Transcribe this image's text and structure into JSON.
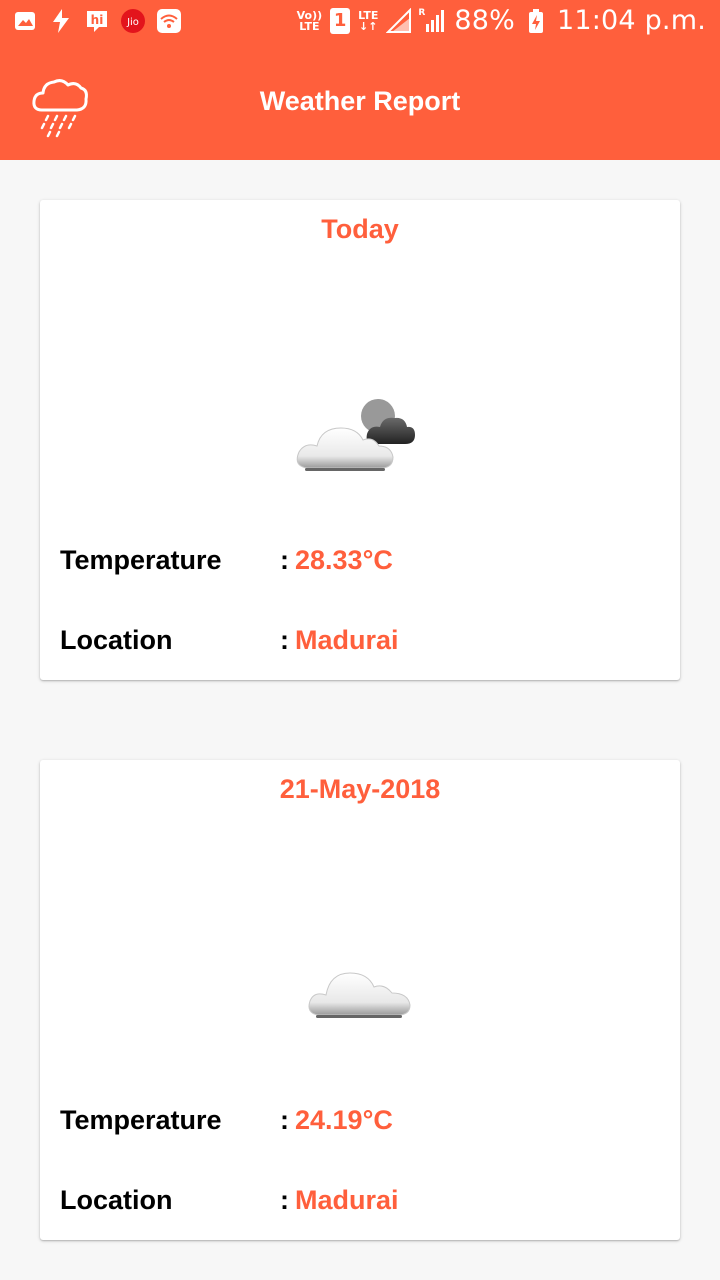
{
  "status_bar": {
    "volte_top": "Vo))",
    "volte_bottom": "LTE",
    "sim": "1",
    "lte": "LTE",
    "roaming": "R",
    "battery": "88%",
    "time": "11:04 p.m.",
    "icons": [
      "image-icon",
      "flash-icon",
      "hike-icon",
      "jio-icon",
      "wifi-icon",
      "volte-icon",
      "sim-icon",
      "lte-icon",
      "signal-icon",
      "battery-icon"
    ]
  },
  "app_bar": {
    "title": "Weather Report",
    "icon": "rain-cloud-icon",
    "color": "#ff5f3c"
  },
  "cards": [
    {
      "heading": "Today",
      "icon": "partly-cloudy-icon",
      "temperature_label": "Temperature",
      "temperature_value": "28.33°C",
      "location_label": "Location",
      "location_value": "Madurai",
      "colon": ":"
    },
    {
      "heading": "21-May-2018",
      "icon": "cloud-icon",
      "temperature_label": "Temperature",
      "temperature_value": "24.19°C",
      "location_label": "Location",
      "location_value": "Madurai",
      "colon": ":"
    }
  ]
}
